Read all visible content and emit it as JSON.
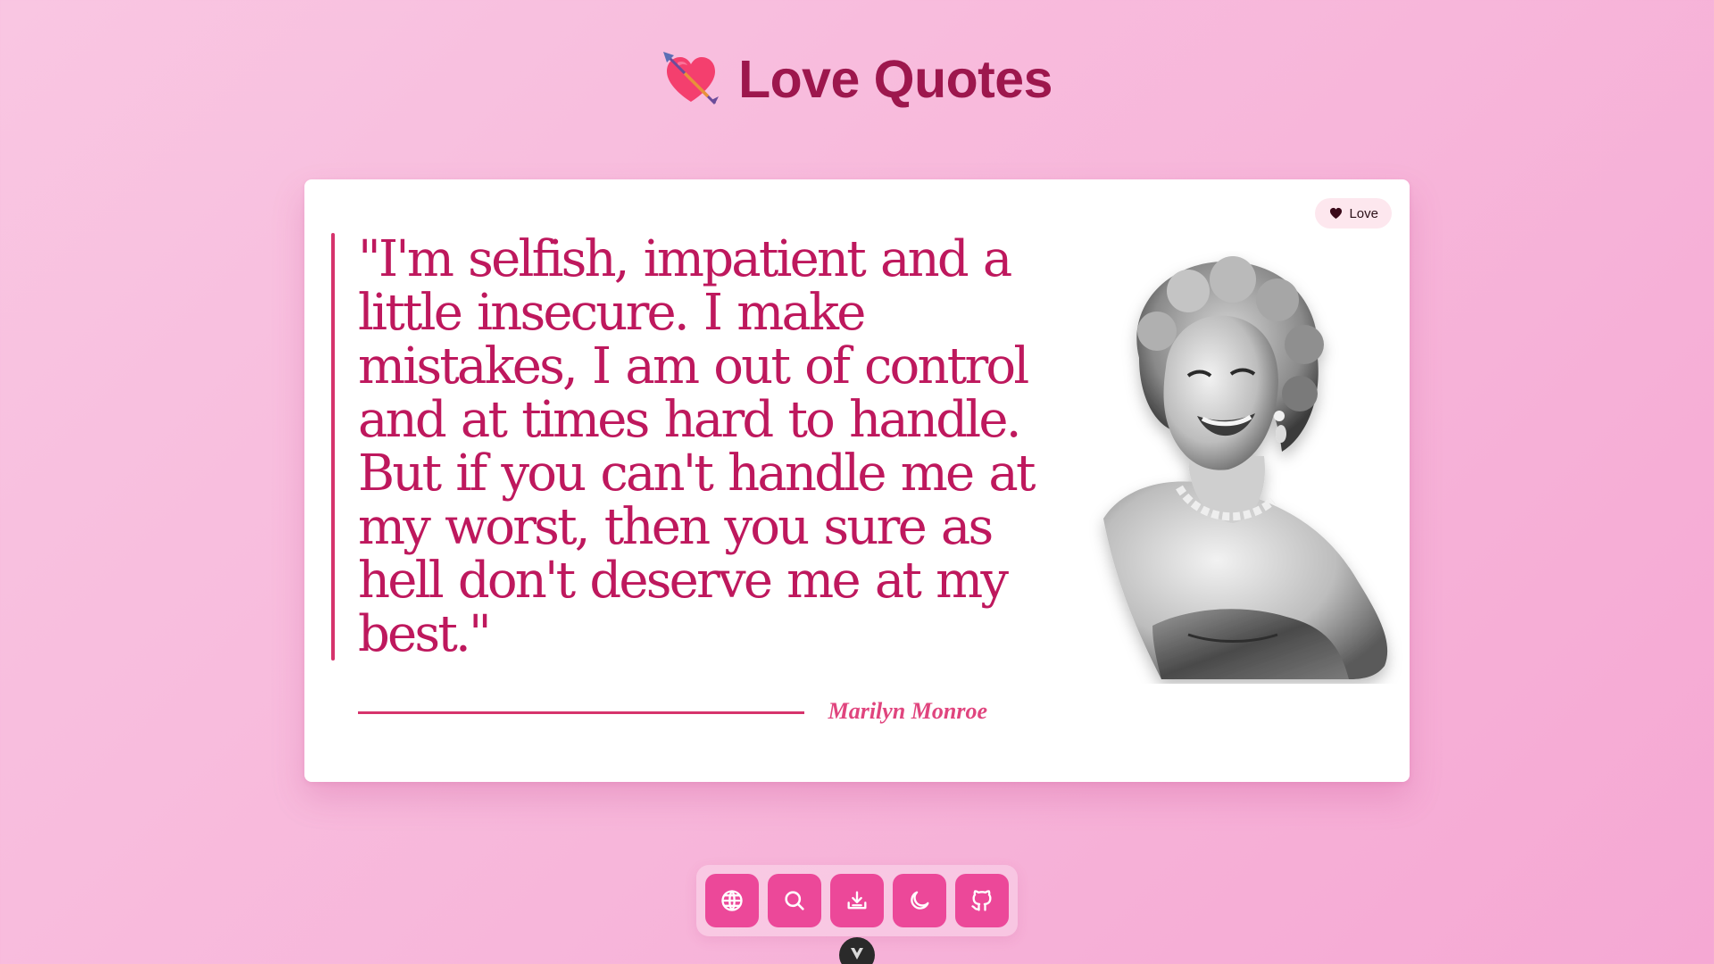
{
  "header": {
    "icon": "heart-with-arrow-icon",
    "title": "Love Quotes"
  },
  "quote_card": {
    "category_badge": {
      "icon": "heart-icon",
      "label": "Love"
    },
    "quote": "\"I'm selfish, impatient and a little insecure. I make mistakes, I am out of control and at times hard to handle. But if you can't handle me at my worst, then you sure as hell don't deserve me at my best.\"",
    "author": "Marilyn Monroe",
    "portrait": "author-portrait"
  },
  "toolbar": {
    "buttons": [
      {
        "icon": "globe-icon"
      },
      {
        "icon": "search-icon"
      },
      {
        "icon": "download-icon"
      },
      {
        "icon": "moon-icon"
      },
      {
        "icon": "github-icon"
      }
    ]
  },
  "floating_tab": {
    "icon": "vue-logo-icon"
  },
  "colors": {
    "background": "#f7b6da",
    "title": "#9d174d",
    "quote_text": "#be185d",
    "accent": "#d6336c",
    "author": "#e0457e",
    "button": "#ec4899",
    "badge_bg": "#fde7ee"
  }
}
